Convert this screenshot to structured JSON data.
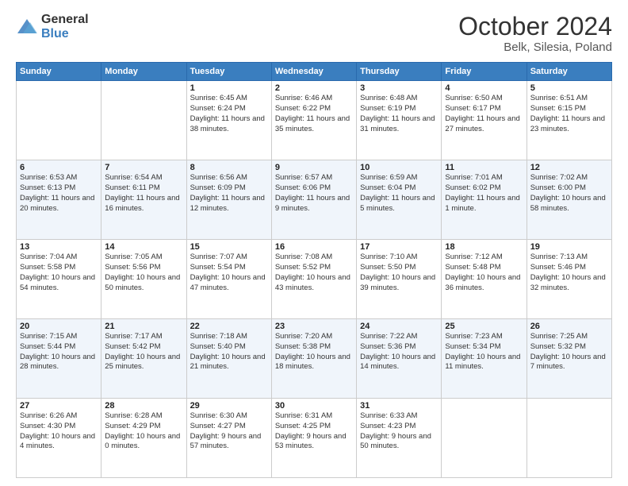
{
  "logo": {
    "general": "General",
    "blue": "Blue"
  },
  "header": {
    "month": "October 2024",
    "location": "Belk, Silesia, Poland"
  },
  "weekdays": [
    "Sunday",
    "Monday",
    "Tuesday",
    "Wednesday",
    "Thursday",
    "Friday",
    "Saturday"
  ],
  "weeks": [
    [
      {
        "day": "",
        "sunrise": "",
        "sunset": "",
        "daylight": ""
      },
      {
        "day": "",
        "sunrise": "",
        "sunset": "",
        "daylight": ""
      },
      {
        "day": "1",
        "sunrise": "Sunrise: 6:45 AM",
        "sunset": "Sunset: 6:24 PM",
        "daylight": "Daylight: 11 hours and 38 minutes."
      },
      {
        "day": "2",
        "sunrise": "Sunrise: 6:46 AM",
        "sunset": "Sunset: 6:22 PM",
        "daylight": "Daylight: 11 hours and 35 minutes."
      },
      {
        "day": "3",
        "sunrise": "Sunrise: 6:48 AM",
        "sunset": "Sunset: 6:19 PM",
        "daylight": "Daylight: 11 hours and 31 minutes."
      },
      {
        "day": "4",
        "sunrise": "Sunrise: 6:50 AM",
        "sunset": "Sunset: 6:17 PM",
        "daylight": "Daylight: 11 hours and 27 minutes."
      },
      {
        "day": "5",
        "sunrise": "Sunrise: 6:51 AM",
        "sunset": "Sunset: 6:15 PM",
        "daylight": "Daylight: 11 hours and 23 minutes."
      }
    ],
    [
      {
        "day": "6",
        "sunrise": "Sunrise: 6:53 AM",
        "sunset": "Sunset: 6:13 PM",
        "daylight": "Daylight: 11 hours and 20 minutes."
      },
      {
        "day": "7",
        "sunrise": "Sunrise: 6:54 AM",
        "sunset": "Sunset: 6:11 PM",
        "daylight": "Daylight: 11 hours and 16 minutes."
      },
      {
        "day": "8",
        "sunrise": "Sunrise: 6:56 AM",
        "sunset": "Sunset: 6:09 PM",
        "daylight": "Daylight: 11 hours and 12 minutes."
      },
      {
        "day": "9",
        "sunrise": "Sunrise: 6:57 AM",
        "sunset": "Sunset: 6:06 PM",
        "daylight": "Daylight: 11 hours and 9 minutes."
      },
      {
        "day": "10",
        "sunrise": "Sunrise: 6:59 AM",
        "sunset": "Sunset: 6:04 PM",
        "daylight": "Daylight: 11 hours and 5 minutes."
      },
      {
        "day": "11",
        "sunrise": "Sunrise: 7:01 AM",
        "sunset": "Sunset: 6:02 PM",
        "daylight": "Daylight: 11 hours and 1 minute."
      },
      {
        "day": "12",
        "sunrise": "Sunrise: 7:02 AM",
        "sunset": "Sunset: 6:00 PM",
        "daylight": "Daylight: 10 hours and 58 minutes."
      }
    ],
    [
      {
        "day": "13",
        "sunrise": "Sunrise: 7:04 AM",
        "sunset": "Sunset: 5:58 PM",
        "daylight": "Daylight: 10 hours and 54 minutes."
      },
      {
        "day": "14",
        "sunrise": "Sunrise: 7:05 AM",
        "sunset": "Sunset: 5:56 PM",
        "daylight": "Daylight: 10 hours and 50 minutes."
      },
      {
        "day": "15",
        "sunrise": "Sunrise: 7:07 AM",
        "sunset": "Sunset: 5:54 PM",
        "daylight": "Daylight: 10 hours and 47 minutes."
      },
      {
        "day": "16",
        "sunrise": "Sunrise: 7:08 AM",
        "sunset": "Sunset: 5:52 PM",
        "daylight": "Daylight: 10 hours and 43 minutes."
      },
      {
        "day": "17",
        "sunrise": "Sunrise: 7:10 AM",
        "sunset": "Sunset: 5:50 PM",
        "daylight": "Daylight: 10 hours and 39 minutes."
      },
      {
        "day": "18",
        "sunrise": "Sunrise: 7:12 AM",
        "sunset": "Sunset: 5:48 PM",
        "daylight": "Daylight: 10 hours and 36 minutes."
      },
      {
        "day": "19",
        "sunrise": "Sunrise: 7:13 AM",
        "sunset": "Sunset: 5:46 PM",
        "daylight": "Daylight: 10 hours and 32 minutes."
      }
    ],
    [
      {
        "day": "20",
        "sunrise": "Sunrise: 7:15 AM",
        "sunset": "Sunset: 5:44 PM",
        "daylight": "Daylight: 10 hours and 28 minutes."
      },
      {
        "day": "21",
        "sunrise": "Sunrise: 7:17 AM",
        "sunset": "Sunset: 5:42 PM",
        "daylight": "Daylight: 10 hours and 25 minutes."
      },
      {
        "day": "22",
        "sunrise": "Sunrise: 7:18 AM",
        "sunset": "Sunset: 5:40 PM",
        "daylight": "Daylight: 10 hours and 21 minutes."
      },
      {
        "day": "23",
        "sunrise": "Sunrise: 7:20 AM",
        "sunset": "Sunset: 5:38 PM",
        "daylight": "Daylight: 10 hours and 18 minutes."
      },
      {
        "day": "24",
        "sunrise": "Sunrise: 7:22 AM",
        "sunset": "Sunset: 5:36 PM",
        "daylight": "Daylight: 10 hours and 14 minutes."
      },
      {
        "day": "25",
        "sunrise": "Sunrise: 7:23 AM",
        "sunset": "Sunset: 5:34 PM",
        "daylight": "Daylight: 10 hours and 11 minutes."
      },
      {
        "day": "26",
        "sunrise": "Sunrise: 7:25 AM",
        "sunset": "Sunset: 5:32 PM",
        "daylight": "Daylight: 10 hours and 7 minutes."
      }
    ],
    [
      {
        "day": "27",
        "sunrise": "Sunrise: 6:26 AM",
        "sunset": "Sunset: 4:30 PM",
        "daylight": "Daylight: 10 hours and 4 minutes."
      },
      {
        "day": "28",
        "sunrise": "Sunrise: 6:28 AM",
        "sunset": "Sunset: 4:29 PM",
        "daylight": "Daylight: 10 hours and 0 minutes."
      },
      {
        "day": "29",
        "sunrise": "Sunrise: 6:30 AM",
        "sunset": "Sunset: 4:27 PM",
        "daylight": "Daylight: 9 hours and 57 minutes."
      },
      {
        "day": "30",
        "sunrise": "Sunrise: 6:31 AM",
        "sunset": "Sunset: 4:25 PM",
        "daylight": "Daylight: 9 hours and 53 minutes."
      },
      {
        "day": "31",
        "sunrise": "Sunrise: 6:33 AM",
        "sunset": "Sunset: 4:23 PM",
        "daylight": "Daylight: 9 hours and 50 minutes."
      },
      {
        "day": "",
        "sunrise": "",
        "sunset": "",
        "daylight": ""
      },
      {
        "day": "",
        "sunrise": "",
        "sunset": "",
        "daylight": ""
      }
    ]
  ]
}
